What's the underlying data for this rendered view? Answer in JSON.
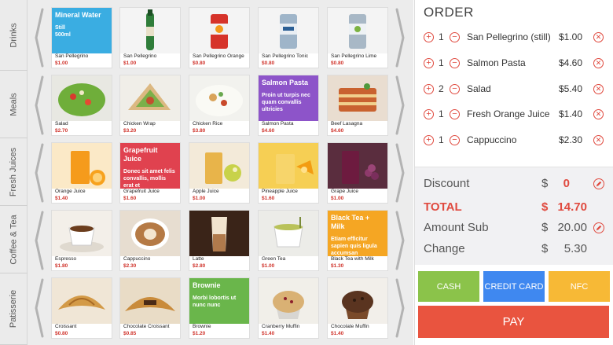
{
  "categories": [
    "Drinks",
    "Meals",
    "Fresh Juices",
    "Coffee & Tea",
    "Patisserie"
  ],
  "colors": {
    "accent": "#e04a3f",
    "cash": "#8bc34a",
    "credit": "#3f88f0",
    "nfc": "#f7b936",
    "pay": "#e9543f",
    "tile_blue": "#3aade2",
    "tile_purple": "#8d54c9",
    "tile_red": "#e0424f",
    "tile_orange": "#f5a623",
    "tile_green": "#6ab64b"
  },
  "rows": [
    [
      {
        "name": "San Pellegrino",
        "price": "$1.00",
        "card": {
          "title": "Mineral Water",
          "body": "Still\n500ml",
          "color": "#3aade2"
        }
      },
      {
        "name": "San Pellegrino",
        "price": "$1.00",
        "icon": "green-bottle-icon"
      },
      {
        "name": "San Pellegrino Orange",
        "price": "$0.80",
        "icon": "orange-can-icon"
      },
      {
        "name": "San Pellegrino Tonic",
        "price": "$0.80",
        "icon": "tonic-can-icon"
      },
      {
        "name": "San Pellegrino Lime",
        "price": "$0.80",
        "icon": "lime-can-icon"
      }
    ],
    [
      {
        "name": "Salad",
        "price": "$2.70",
        "icon": "salad-icon"
      },
      {
        "name": "Chicken Wrap",
        "price": "$3.20",
        "icon": "wrap-icon"
      },
      {
        "name": "Chicken Rice",
        "price": "$3.80",
        "icon": "rice-icon"
      },
      {
        "name": "Salmon Pasta",
        "price": "$4.60",
        "card": {
          "title": "Salmon Pasta",
          "body": "Proin ut turpis nec quam convallis ultricies",
          "color": "#8d54c9"
        }
      },
      {
        "name": "Beef Lasagna",
        "price": "$4.60",
        "icon": "lasagna-icon"
      }
    ],
    [
      {
        "name": "Orange Juice",
        "price": "$1.40",
        "icon": "orange-juice-icon"
      },
      {
        "name": "Grapefruit Juice",
        "price": "$1.60",
        "card": {
          "title": "Grapefruit Juice",
          "body": "Donec sit amet felis convallis, mollis erat et",
          "color": "#e0424f"
        }
      },
      {
        "name": "Apple Juice",
        "price": "$1.00",
        "icon": "apple-juice-icon"
      },
      {
        "name": "Pineapple Juice",
        "price": "$1.60",
        "icon": "pineapple-juice-icon"
      },
      {
        "name": "Grape Juice",
        "price": "$1.00",
        "icon": "grape-juice-icon"
      }
    ],
    [
      {
        "name": "Espresso",
        "price": "$1.80",
        "icon": "espresso-icon"
      },
      {
        "name": "Cappuccino",
        "price": "$2.30",
        "icon": "cappuccino-icon"
      },
      {
        "name": "Latte",
        "price": "$2.80",
        "icon": "latte-icon"
      },
      {
        "name": "Green Tea",
        "price": "$1.00",
        "icon": "green-tea-icon"
      },
      {
        "name": "Black Tea with Milk",
        "price": "$1.30",
        "card": {
          "title": "Black Tea + Milk",
          "body": "Etiam efficitur sapien quis ligula accumsan",
          "color": "#f5a623"
        }
      }
    ],
    [
      {
        "name": "Croissant",
        "price": "$0.80",
        "icon": "croissant-icon"
      },
      {
        "name": "Chocolate Croissant",
        "price": "$0.85",
        "icon": "chocolate-croissant-icon"
      },
      {
        "name": "Brownie",
        "price": "$1.20",
        "card": {
          "title": "Brownie",
          "body": "Morbi lobortis ut nunc nunc",
          "color": "#6ab64b"
        }
      },
      {
        "name": "Cranberry Muffin",
        "price": "$1.40",
        "icon": "cranberry-muffin-icon"
      },
      {
        "name": "Chocolate Muffin",
        "price": "$1.40",
        "icon": "chocolate-muffin-icon"
      }
    ]
  ],
  "order": {
    "title": "ORDER",
    "plus_glyph": "+",
    "minus_glyph": "−",
    "delete_glyph": "✕",
    "lines": [
      {
        "qty": "1",
        "name": "San Pellegrino (still)",
        "price": "$1.00"
      },
      {
        "qty": "1",
        "name": "Salmon Pasta",
        "price": "$4.60"
      },
      {
        "qty": "2",
        "name": "Salad",
        "price": "$5.40"
      },
      {
        "qty": "1",
        "name": "Fresh Orange Juice",
        "price": "$1.40"
      },
      {
        "qty": "1",
        "name": "Cappuccino",
        "price": "$2.30"
      }
    ]
  },
  "totals": {
    "currency": "$",
    "discount_label": "Discount",
    "discount_value": "0",
    "total_label": "TOTAL",
    "total_value": "14.70",
    "amount_label": "Amount Sub",
    "amount_value": "20.00",
    "change_label": "Change",
    "change_value": "5.30"
  },
  "buttons": {
    "cash": "CASH",
    "credit": "CREDIT CARD",
    "nfc": "NFC",
    "pay": "PAY"
  }
}
